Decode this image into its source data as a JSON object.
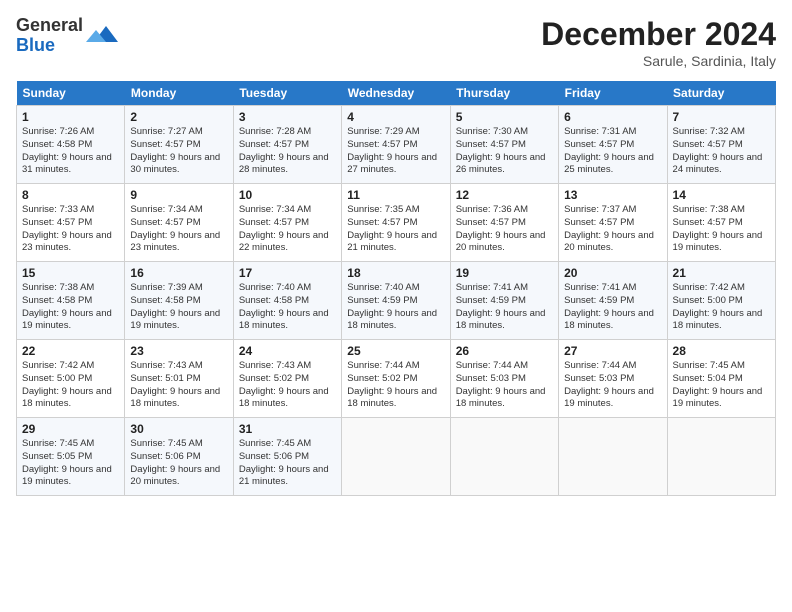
{
  "header": {
    "logo_line1": "General",
    "logo_line2": "Blue",
    "month": "December 2024",
    "location": "Sarule, Sardinia, Italy"
  },
  "weekdays": [
    "Sunday",
    "Monday",
    "Tuesday",
    "Wednesday",
    "Thursday",
    "Friday",
    "Saturday"
  ],
  "weeks": [
    [
      {
        "day": "1",
        "sunrise": "Sunrise: 7:26 AM",
        "sunset": "Sunset: 4:58 PM",
        "daylight": "Daylight: 9 hours and 31 minutes."
      },
      {
        "day": "2",
        "sunrise": "Sunrise: 7:27 AM",
        "sunset": "Sunset: 4:57 PM",
        "daylight": "Daylight: 9 hours and 30 minutes."
      },
      {
        "day": "3",
        "sunrise": "Sunrise: 7:28 AM",
        "sunset": "Sunset: 4:57 PM",
        "daylight": "Daylight: 9 hours and 28 minutes."
      },
      {
        "day": "4",
        "sunrise": "Sunrise: 7:29 AM",
        "sunset": "Sunset: 4:57 PM",
        "daylight": "Daylight: 9 hours and 27 minutes."
      },
      {
        "day": "5",
        "sunrise": "Sunrise: 7:30 AM",
        "sunset": "Sunset: 4:57 PM",
        "daylight": "Daylight: 9 hours and 26 minutes."
      },
      {
        "day": "6",
        "sunrise": "Sunrise: 7:31 AM",
        "sunset": "Sunset: 4:57 PM",
        "daylight": "Daylight: 9 hours and 25 minutes."
      },
      {
        "day": "7",
        "sunrise": "Sunrise: 7:32 AM",
        "sunset": "Sunset: 4:57 PM",
        "daylight": "Daylight: 9 hours and 24 minutes."
      }
    ],
    [
      {
        "day": "8",
        "sunrise": "Sunrise: 7:33 AM",
        "sunset": "Sunset: 4:57 PM",
        "daylight": "Daylight: 9 hours and 23 minutes."
      },
      {
        "day": "9",
        "sunrise": "Sunrise: 7:34 AM",
        "sunset": "Sunset: 4:57 PM",
        "daylight": "Daylight: 9 hours and 23 minutes."
      },
      {
        "day": "10",
        "sunrise": "Sunrise: 7:34 AM",
        "sunset": "Sunset: 4:57 PM",
        "daylight": "Daylight: 9 hours and 22 minutes."
      },
      {
        "day": "11",
        "sunrise": "Sunrise: 7:35 AM",
        "sunset": "Sunset: 4:57 PM",
        "daylight": "Daylight: 9 hours and 21 minutes."
      },
      {
        "day": "12",
        "sunrise": "Sunrise: 7:36 AM",
        "sunset": "Sunset: 4:57 PM",
        "daylight": "Daylight: 9 hours and 20 minutes."
      },
      {
        "day": "13",
        "sunrise": "Sunrise: 7:37 AM",
        "sunset": "Sunset: 4:57 PM",
        "daylight": "Daylight: 9 hours and 20 minutes."
      },
      {
        "day": "14",
        "sunrise": "Sunrise: 7:38 AM",
        "sunset": "Sunset: 4:57 PM",
        "daylight": "Daylight: 9 hours and 19 minutes."
      }
    ],
    [
      {
        "day": "15",
        "sunrise": "Sunrise: 7:38 AM",
        "sunset": "Sunset: 4:58 PM",
        "daylight": "Daylight: 9 hours and 19 minutes."
      },
      {
        "day": "16",
        "sunrise": "Sunrise: 7:39 AM",
        "sunset": "Sunset: 4:58 PM",
        "daylight": "Daylight: 9 hours and 19 minutes."
      },
      {
        "day": "17",
        "sunrise": "Sunrise: 7:40 AM",
        "sunset": "Sunset: 4:58 PM",
        "daylight": "Daylight: 9 hours and 18 minutes."
      },
      {
        "day": "18",
        "sunrise": "Sunrise: 7:40 AM",
        "sunset": "Sunset: 4:59 PM",
        "daylight": "Daylight: 9 hours and 18 minutes."
      },
      {
        "day": "19",
        "sunrise": "Sunrise: 7:41 AM",
        "sunset": "Sunset: 4:59 PM",
        "daylight": "Daylight: 9 hours and 18 minutes."
      },
      {
        "day": "20",
        "sunrise": "Sunrise: 7:41 AM",
        "sunset": "Sunset: 4:59 PM",
        "daylight": "Daylight: 9 hours and 18 minutes."
      },
      {
        "day": "21",
        "sunrise": "Sunrise: 7:42 AM",
        "sunset": "Sunset: 5:00 PM",
        "daylight": "Daylight: 9 hours and 18 minutes."
      }
    ],
    [
      {
        "day": "22",
        "sunrise": "Sunrise: 7:42 AM",
        "sunset": "Sunset: 5:00 PM",
        "daylight": "Daylight: 9 hours and 18 minutes."
      },
      {
        "day": "23",
        "sunrise": "Sunrise: 7:43 AM",
        "sunset": "Sunset: 5:01 PM",
        "daylight": "Daylight: 9 hours and 18 minutes."
      },
      {
        "day": "24",
        "sunrise": "Sunrise: 7:43 AM",
        "sunset": "Sunset: 5:02 PM",
        "daylight": "Daylight: 9 hours and 18 minutes."
      },
      {
        "day": "25",
        "sunrise": "Sunrise: 7:44 AM",
        "sunset": "Sunset: 5:02 PM",
        "daylight": "Daylight: 9 hours and 18 minutes."
      },
      {
        "day": "26",
        "sunrise": "Sunrise: 7:44 AM",
        "sunset": "Sunset: 5:03 PM",
        "daylight": "Daylight: 9 hours and 18 minutes."
      },
      {
        "day": "27",
        "sunrise": "Sunrise: 7:44 AM",
        "sunset": "Sunset: 5:03 PM",
        "daylight": "Daylight: 9 hours and 19 minutes."
      },
      {
        "day": "28",
        "sunrise": "Sunrise: 7:45 AM",
        "sunset": "Sunset: 5:04 PM",
        "daylight": "Daylight: 9 hours and 19 minutes."
      }
    ],
    [
      {
        "day": "29",
        "sunrise": "Sunrise: 7:45 AM",
        "sunset": "Sunset: 5:05 PM",
        "daylight": "Daylight: 9 hours and 19 minutes."
      },
      {
        "day": "30",
        "sunrise": "Sunrise: 7:45 AM",
        "sunset": "Sunset: 5:06 PM",
        "daylight": "Daylight: 9 hours and 20 minutes."
      },
      {
        "day": "31",
        "sunrise": "Sunrise: 7:45 AM",
        "sunset": "Sunset: 5:06 PM",
        "daylight": "Daylight: 9 hours and 21 minutes."
      },
      null,
      null,
      null,
      null
    ]
  ]
}
